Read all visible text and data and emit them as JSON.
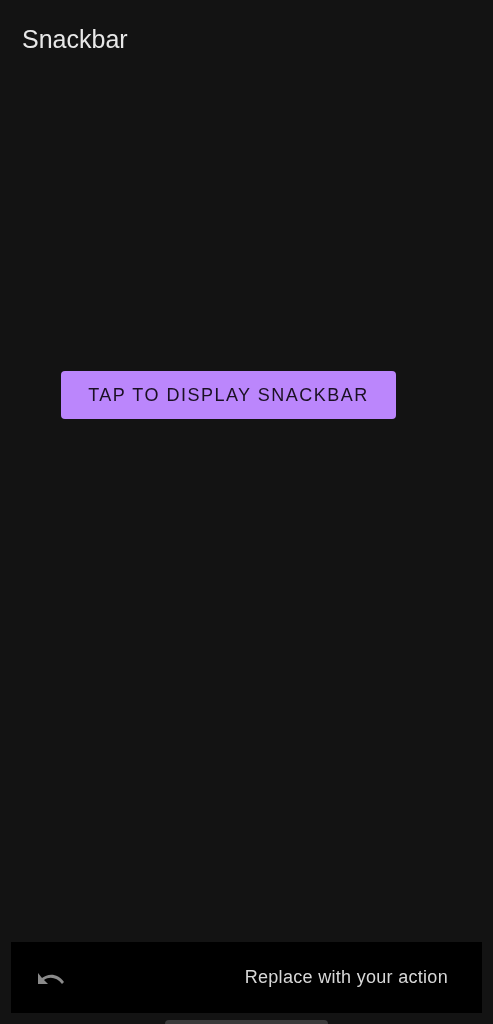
{
  "app_bar": {
    "title": "Snackbar"
  },
  "button": {
    "label": "TAP TO DISPLAY SNACKBAR"
  },
  "snackbar": {
    "message": "Replace with your action"
  }
}
